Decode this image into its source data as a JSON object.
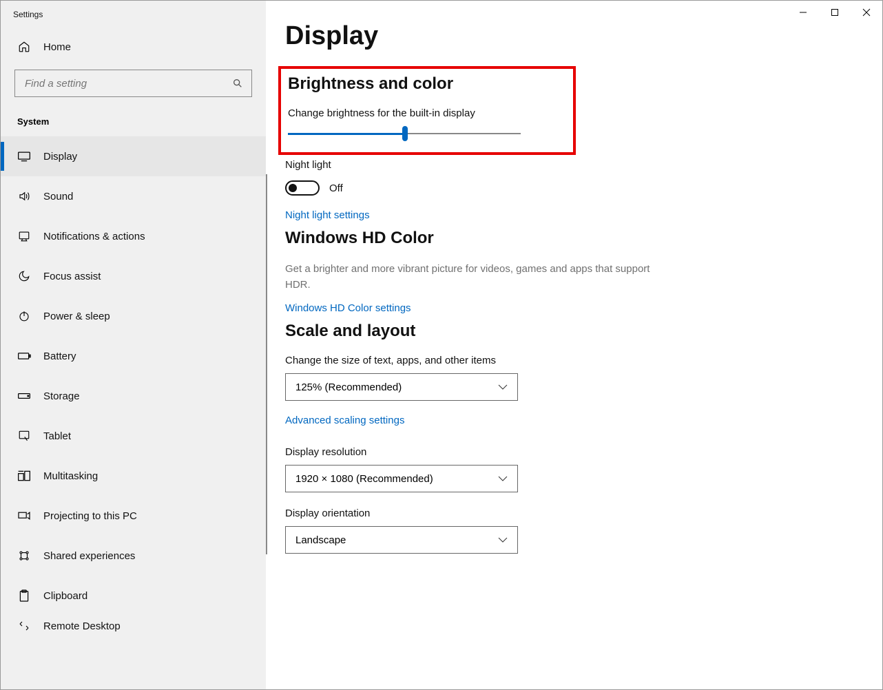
{
  "window": {
    "title": "Settings"
  },
  "sidebar": {
    "home": "Home",
    "search_placeholder": "Find a setting",
    "category": "System",
    "items": [
      {
        "label": "Display",
        "icon": "display"
      },
      {
        "label": "Sound",
        "icon": "sound"
      },
      {
        "label": "Notifications & actions",
        "icon": "notifications"
      },
      {
        "label": "Focus assist",
        "icon": "moon"
      },
      {
        "label": "Power & sleep",
        "icon": "power"
      },
      {
        "label": "Battery",
        "icon": "battery"
      },
      {
        "label": "Storage",
        "icon": "storage"
      },
      {
        "label": "Tablet",
        "icon": "tablet"
      },
      {
        "label": "Multitasking",
        "icon": "multitask"
      },
      {
        "label": "Projecting to this PC",
        "icon": "project"
      },
      {
        "label": "Shared experiences",
        "icon": "shared"
      },
      {
        "label": "Clipboard",
        "icon": "clipboard"
      },
      {
        "label": "Remote Desktop",
        "icon": "remote"
      }
    ]
  },
  "page": {
    "title": "Display",
    "brightness_section": "Brightness and color",
    "brightness_label": "Change brightness for the built-in display",
    "brightness_percent": 50,
    "night_light_label": "Night light",
    "night_light_state": "Off",
    "night_light_link": "Night light settings",
    "hd_section": "Windows HD Color",
    "hd_desc": "Get a brighter and more vibrant picture for videos, games and apps that support HDR.",
    "hd_link": "Windows HD Color settings",
    "scale_section": "Scale and layout",
    "scale_label": "Change the size of text, apps, and other items",
    "scale_value": "125% (Recommended)",
    "scale_link": "Advanced scaling settings",
    "resolution_label": "Display resolution",
    "resolution_value": "1920 × 1080 (Recommended)",
    "orientation_label": "Display orientation",
    "orientation_value": "Landscape"
  }
}
